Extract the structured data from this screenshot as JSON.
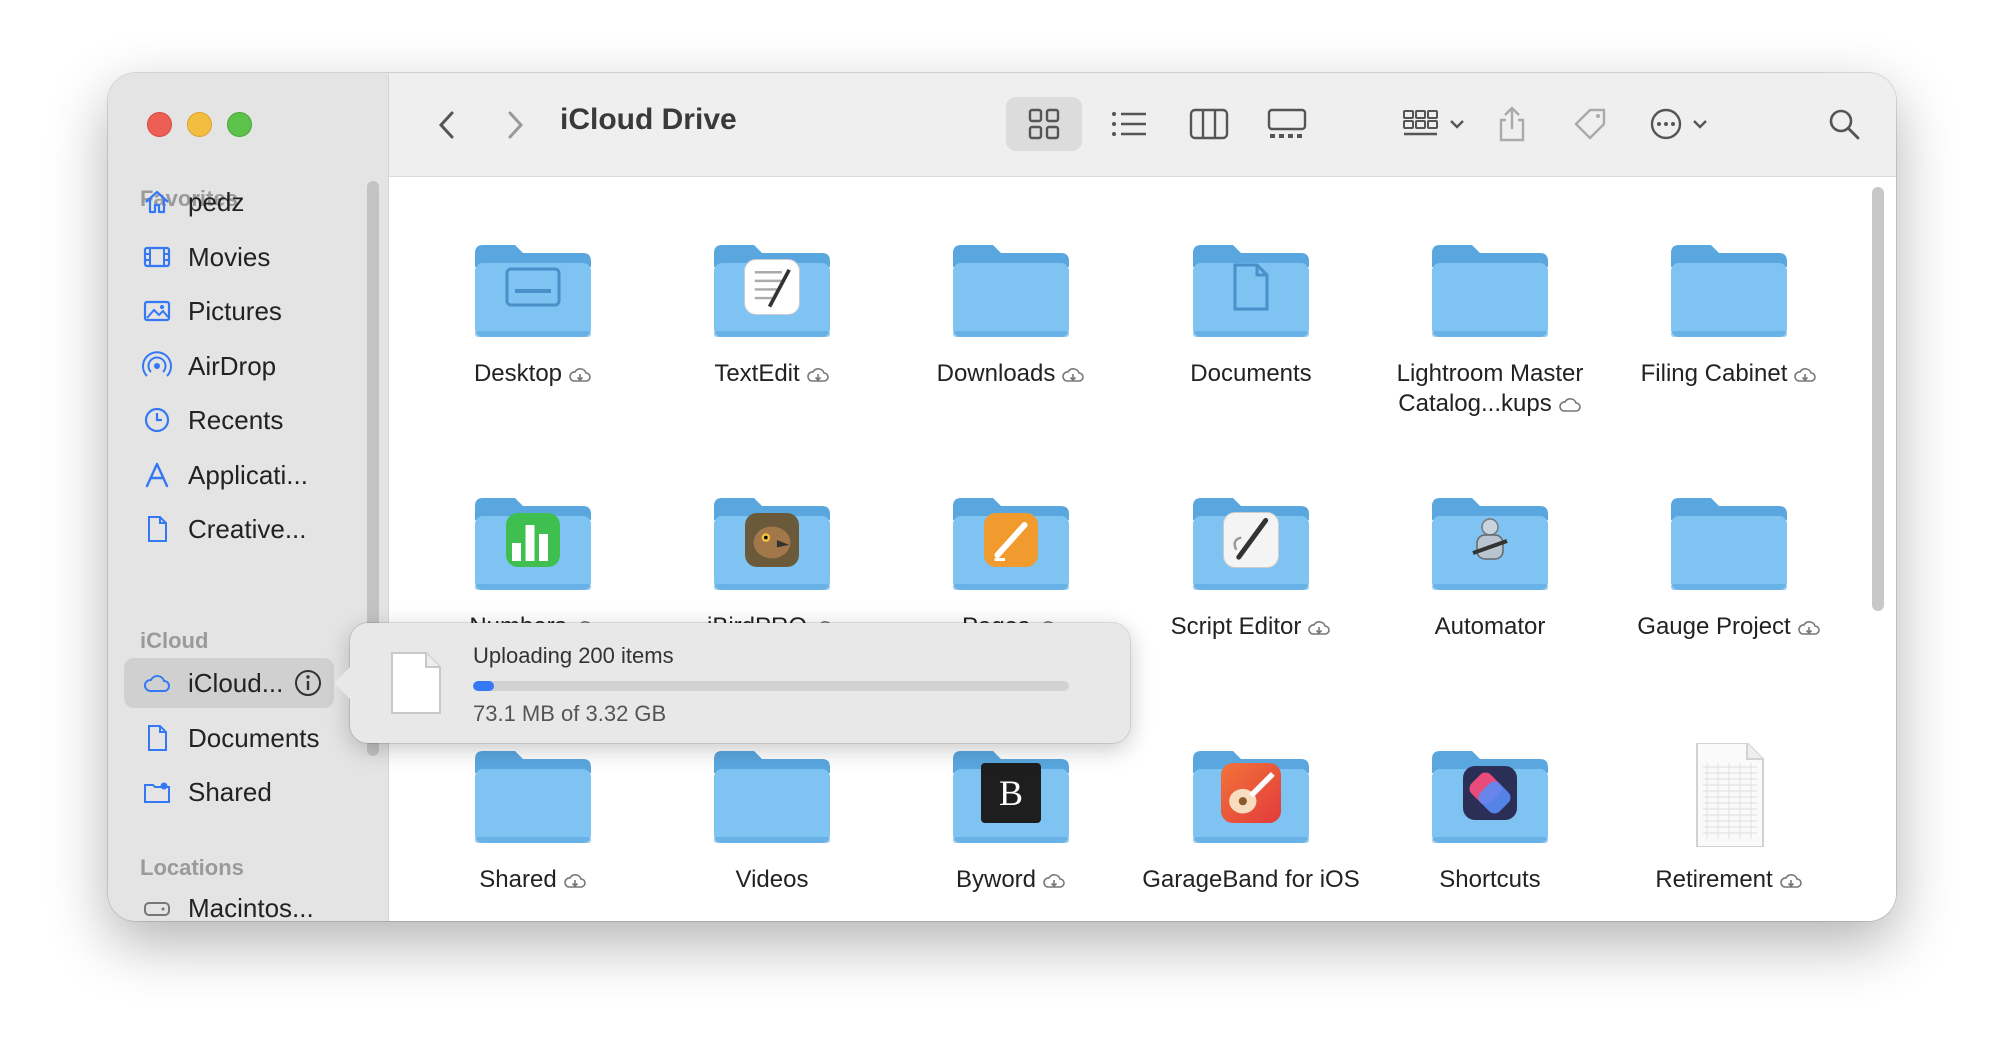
{
  "window": {
    "title": "iCloud Drive"
  },
  "sidebar": {
    "sections": [
      {
        "header": "Favorites",
        "items": [
          {
            "label": "pedz",
            "icon": "home-icon"
          },
          {
            "label": "Movies",
            "icon": "film-icon"
          },
          {
            "label": "Pictures",
            "icon": "photo-icon"
          },
          {
            "label": "AirDrop",
            "icon": "airdrop-icon"
          },
          {
            "label": "Recents",
            "icon": "clock-icon"
          },
          {
            "label": "Applicati...",
            "icon": "applications-icon"
          },
          {
            "label": "Creative...",
            "icon": "document-icon"
          }
        ]
      },
      {
        "header": "iCloud",
        "items": [
          {
            "label": "iCloud...",
            "icon": "cloud-icon",
            "selected": true
          },
          {
            "label": "Documents",
            "icon": "document-icon"
          },
          {
            "label": "Shared",
            "icon": "shared-folder-icon"
          }
        ]
      },
      {
        "header": "Locations",
        "items": [
          {
            "label": "Macintos...",
            "icon": "disk-icon"
          }
        ]
      }
    ]
  },
  "toolbar": {
    "buttons": [
      "back",
      "forward",
      "icon-view",
      "list-view",
      "column-view",
      "gallery-view",
      "group-by",
      "share",
      "tag",
      "more",
      "search"
    ]
  },
  "files": [
    {
      "name": "Desktop",
      "cloud": "download",
      "icon": "desktop-glyph"
    },
    {
      "name": "TextEdit",
      "cloud": "download",
      "icon": "textedit-app"
    },
    {
      "name": "Downloads",
      "cloud": "download",
      "icon": "none"
    },
    {
      "name": "Documents",
      "cloud": "none",
      "icon": "document-glyph"
    },
    {
      "name": "Lightroom Master Catalog...kups",
      "cloud": "outline",
      "icon": "none"
    },
    {
      "name": "Filing Cabinet",
      "cloud": "download",
      "icon": "none"
    },
    {
      "name": "Numbers",
      "cloud": "download",
      "icon": "numbers-app"
    },
    {
      "name": "iBirdPRO",
      "cloud": "download",
      "icon": "bird-app"
    },
    {
      "name": "Pages",
      "cloud": "download",
      "icon": "pages-app"
    },
    {
      "name": "Script Editor",
      "cloud": "download",
      "icon": "script-editor-app"
    },
    {
      "name": "Automator",
      "cloud": "none",
      "icon": "automator-app"
    },
    {
      "name": "Gauge Project",
      "cloud": "download",
      "icon": "none"
    },
    {
      "name": "Shared",
      "cloud": "download",
      "icon": "none"
    },
    {
      "name": "Videos",
      "cloud": "none",
      "icon": "none"
    },
    {
      "name": "Byword",
      "cloud": "download",
      "icon": "byword-app"
    },
    {
      "name": "GarageBand for iOS",
      "cloud": "none",
      "icon": "garageband-app"
    },
    {
      "name": "Shortcuts",
      "cloud": "none",
      "icon": "shortcuts-app"
    },
    {
      "name": "Retirement",
      "cloud": "download",
      "icon": "spreadsheet-doc"
    }
  ],
  "upload_popover": {
    "title": "Uploading 200 items",
    "detail": "73.1 MB of 3.32 GB",
    "progress_fraction": 0.022
  },
  "colors": {
    "folder": "#7ec3f2",
    "folder_dark": "#5aa7e0",
    "accent": "#3478f6"
  }
}
